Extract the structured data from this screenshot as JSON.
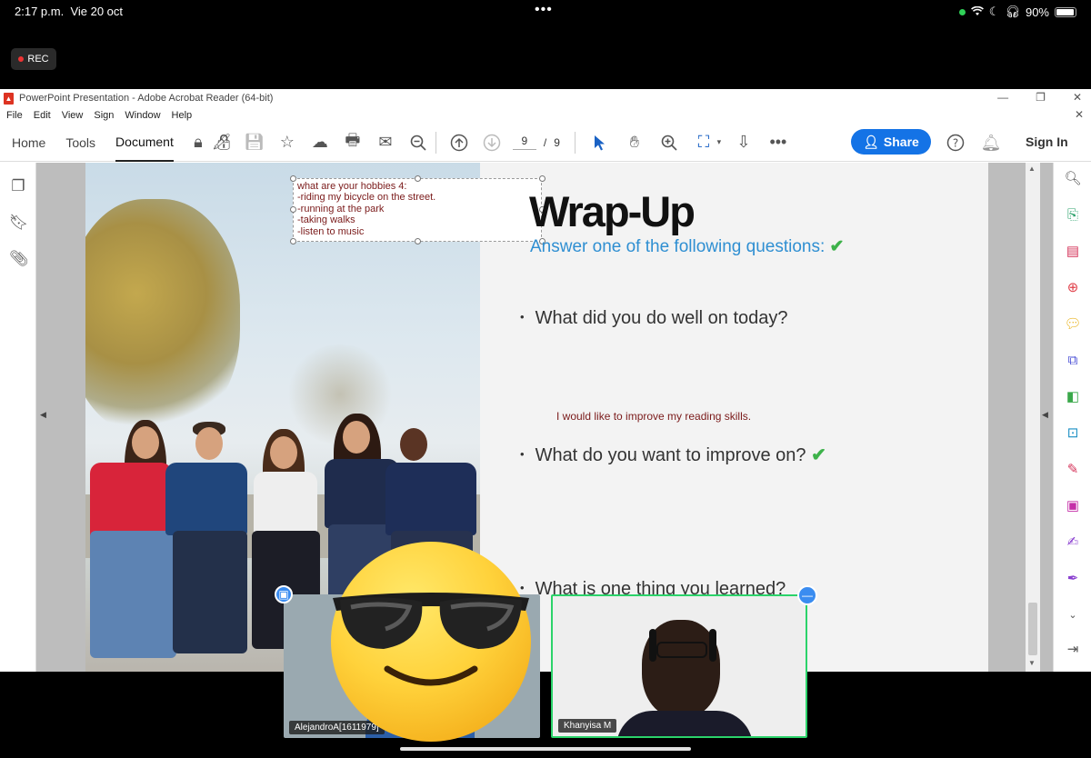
{
  "status_bar": {
    "time": "2:17 p.m.",
    "date": "Vie 20 oct",
    "battery": "90%"
  },
  "rec_label": "REC",
  "window": {
    "title": "PowerPoint Presentation - Adobe Acrobat Reader (64-bit)",
    "menu": [
      "File",
      "Edit",
      "View",
      "Sign",
      "Window",
      "Help"
    ]
  },
  "toolbar": {
    "nav": [
      "Home",
      "Tools",
      "Document"
    ],
    "page_current": "9",
    "page_sep": "/",
    "page_total": "9",
    "share_label": "Share",
    "signin_label": "Sign In"
  },
  "slide": {
    "annotation": "what are your hobbies 4:\n-riding my bicycle on the street.\n-running at the park\n-taking walks\n-listen to music",
    "title": "Wrap-Up",
    "subtitle": "Answer one of the following questions:",
    "bullets": [
      "What did you do well on today?",
      "What do you want to improve on?",
      "What is one thing you learned?"
    ],
    "answer": "I would like to improve my reading skills."
  },
  "participants": [
    {
      "name": "AlejandroA[1611979]"
    },
    {
      "name": "Khanyisa M"
    }
  ],
  "colors": {
    "accent_blue": "#1473e6",
    "subtitle_blue": "#2f8fd2",
    "check_green": "#3db24a",
    "speaker_border": "#2bd36a"
  }
}
